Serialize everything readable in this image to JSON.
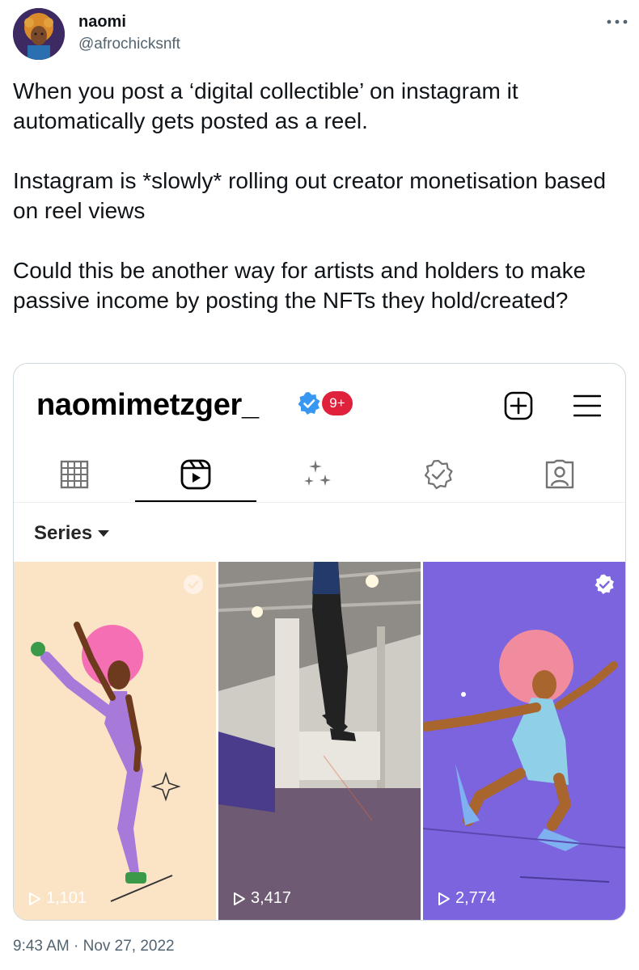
{
  "author": {
    "name": "naomi",
    "handle": "@afrochicksnft"
  },
  "tweet": {
    "paragraphs": [
      "When you post a ‘digital collectible’ on instagram it automatically gets posted as a reel.",
      "Instagram is *slowly* rolling out creator monetisation based on reel views",
      "Could this be another way for artists and holders to make passive income by posting the NFTs they hold/created?"
    ],
    "timestamp": "9:43 AM · Nov 27, 2022"
  },
  "instagram": {
    "username": "naomimetzger_",
    "notification_badge": "9+",
    "series_label": "Series",
    "tabs": [
      "grid",
      "reels",
      "sparkles",
      "collectibles",
      "tagged"
    ],
    "active_tab": "reels",
    "reels": [
      {
        "views": "1,101"
      },
      {
        "views": "3,417"
      },
      {
        "views": "2,774"
      }
    ]
  },
  "colors": {
    "verified_blue": "#3897f0",
    "notification_red": "#e0213b",
    "reel1_bg": "#fbe3c6",
    "reel3_bg": "#7c64de",
    "handle_gray": "#536471"
  }
}
